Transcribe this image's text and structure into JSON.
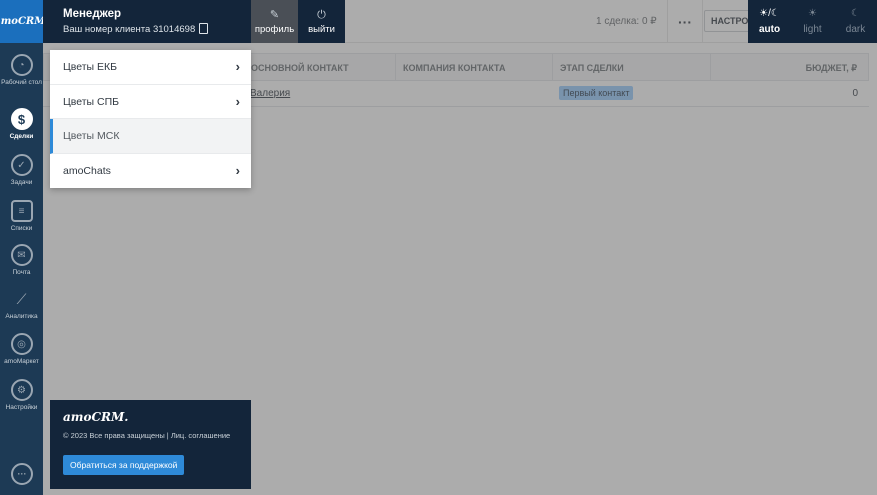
{
  "app": {
    "logo": "amoCRM."
  },
  "topbar": {
    "deals_count": "1 сделка: 0 ₽",
    "more_icon": "more-dots-icon",
    "settings_label": "НАСТРОЙКИ"
  },
  "table": {
    "columns": [
      "ОСНОВНОЙ КОНТАКТ",
      "КОМПАНИЯ КОНТАКТА",
      "ЭТАП СДЕЛКИ",
      "БЮДЖЕТ, ₽"
    ],
    "rows": [
      {
        "contact": "Валерия",
        "company": "",
        "stage": "Первый контакт",
        "budget": "0"
      }
    ],
    "stage_color": "#99ccff"
  },
  "sidebar": {
    "items": [
      {
        "label": "Рабочий стол",
        "icon": "speedometer-icon"
      },
      {
        "label": "Сделки",
        "icon": "dollar-icon",
        "active": true
      },
      {
        "label": "Задачи",
        "icon": "checkmark-icon"
      },
      {
        "label": "Списки",
        "icon": "list-icon"
      },
      {
        "label": "Почта",
        "icon": "mail-icon"
      },
      {
        "label": "Аналитика",
        "icon": "chart-icon"
      },
      {
        "label": "amoМаркет",
        "icon": "market-icon"
      },
      {
        "label": "Настройки",
        "icon": "gear-icon"
      }
    ],
    "chat_icon": "chat-icon"
  },
  "user": {
    "name": "Менеджер",
    "client_id": "Ваш номер клиента 31014698",
    "profile_label": "профиль",
    "logout_label": "выйти"
  },
  "menu": {
    "items": [
      {
        "label": "Цветы ЕКБ",
        "has_arrow": true
      },
      {
        "label": "Цветы СПБ",
        "has_arrow": true
      },
      {
        "label": "Цветы МСК",
        "has_arrow": false,
        "selected": true
      },
      {
        "label": "amoChats",
        "has_arrow": true
      }
    ]
  },
  "footer": {
    "logo": "amoCRM.",
    "copyright": "© 2023 Все права защищены | Лиц. соглашение",
    "support_label": "Обратиться за поддержкой"
  },
  "theme": {
    "options": [
      {
        "label": "auto",
        "icon": "auto-theme-icon",
        "active": true
      },
      {
        "label": "light",
        "icon": "sun-icon"
      },
      {
        "label": "dark",
        "icon": "moon-icon"
      }
    ]
  },
  "colors": {
    "sidebar_bg": "#1d3a55",
    "panel_bg": "#13253a",
    "accent": "#2e8ad8",
    "logo_bg": "#1b6fbd"
  }
}
